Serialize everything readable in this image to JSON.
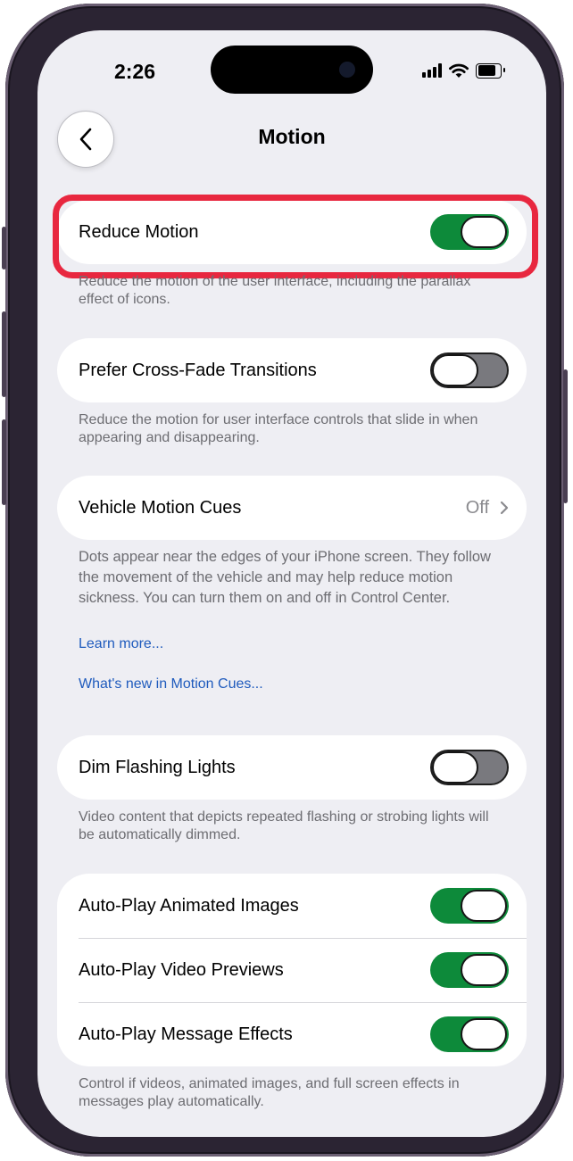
{
  "status_bar": {
    "time": "2:26"
  },
  "nav": {
    "title": "Motion"
  },
  "sections": {
    "reduce_motion": {
      "label": "Reduce Motion",
      "toggle": "on",
      "footer": "Reduce the motion of the user interface, including the parallax effect of icons."
    },
    "cross_fade": {
      "label": "Prefer Cross-Fade Transitions",
      "toggle": "off",
      "footer": "Reduce the motion for user interface controls that slide in when appearing and disappearing."
    },
    "vehicle": {
      "label": "Vehicle Motion Cues",
      "value": "Off",
      "footer": "Dots appear near the edges of your iPhone screen. They follow the movement of the vehicle and may help reduce motion sickness. You can turn them on and off in Control Center.",
      "learn_more": "Learn more...",
      "whats_new": "What's new in Motion Cues..."
    },
    "dim_flashing": {
      "label": "Dim Flashing Lights",
      "toggle": "off",
      "footer": "Video content that depicts repeated flashing or strobing lights will be automatically dimmed."
    },
    "autoplay": {
      "rows": [
        {
          "label": "Auto-Play Animated Images",
          "toggle": "on"
        },
        {
          "label": "Auto-Play Video Previews",
          "toggle": "on"
        },
        {
          "label": "Auto-Play Message Effects",
          "toggle": "on"
        }
      ],
      "footer": "Control if videos, animated images, and full screen effects in messages play automatically."
    }
  },
  "colors": {
    "toggle_on": "#0d8a3a",
    "highlight": "#e8273f",
    "link": "#1f5bbd",
    "background": "#eeeef3"
  },
  "icons": [
    "chevron-left-icon",
    "cellular-signal-icon",
    "wifi-icon",
    "battery-icon",
    "chevron-right-icon"
  ]
}
